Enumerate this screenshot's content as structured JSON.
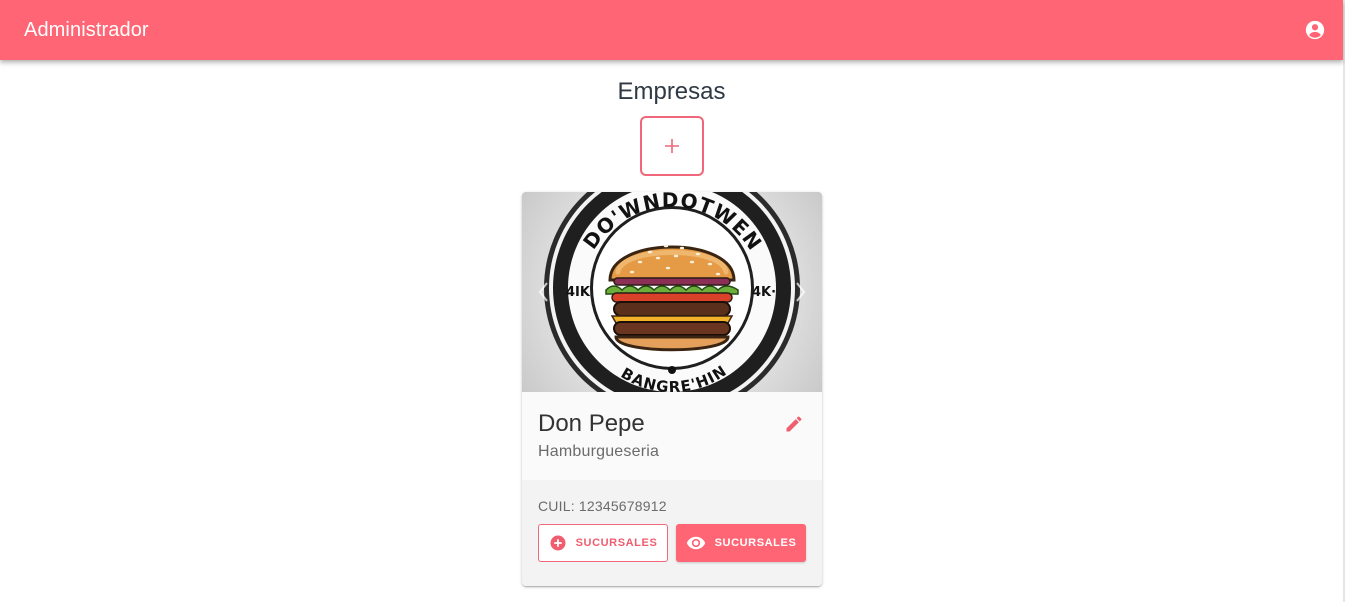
{
  "app": {
    "title": "Administrador",
    "brand_color": "#ff6574",
    "account_icon": "account-circle-icon"
  },
  "page": {
    "title": "Empresas",
    "add_icon": "plus-icon"
  },
  "company_card": {
    "name": "Don Pepe",
    "category": "Hamburgueseria",
    "cuil_text": "CUIL: 12345678912",
    "edit_icon": "pencil-icon",
    "image_logo_text": {
      "top": "DO'WNDOTWEN",
      "bottom": "BANGRE'HIN",
      "left": "4IK",
      "right": "4K·"
    },
    "actions": [
      {
        "label": "Sucursales",
        "icon": "plus-circle-icon",
        "style": "outlined"
      },
      {
        "label": "Sucursales",
        "icon": "eye-icon",
        "style": "filled"
      }
    ]
  }
}
